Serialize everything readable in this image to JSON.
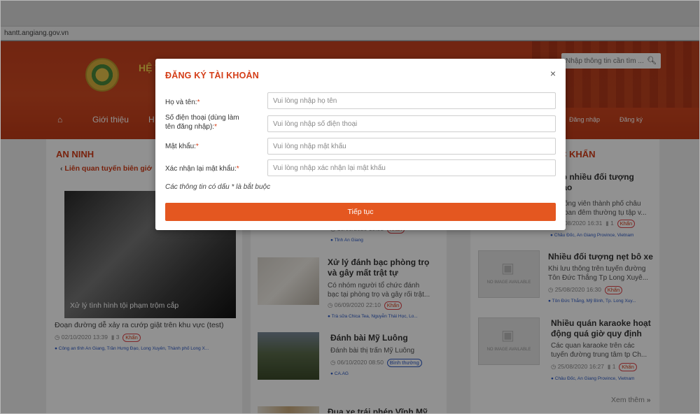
{
  "browser": {
    "url": "hantt.angiang.gov.vn"
  },
  "header": {
    "site_title": "HỆ T",
    "search_placeholder": "Nhập thông tin cần tìm ...",
    "nav": {
      "home": "Giới thiệu",
      "partial": "H",
      "login": "Đăng nhập",
      "register": "Đăng ký"
    }
  },
  "left": {
    "section_title": "AN NINH",
    "sub_link": "Liên quan tuyến biên giớ",
    "featured": {
      "image_caption": "Xử lý tình hình tội phạm trộm cắp",
      "title": "Đoạn đường dễ xảy ra cướp giật trên khu vực (test)",
      "date": "02/10/2020 13:39",
      "comments": "3",
      "badge": "Khẩn",
      "location": "Công an tỉnh An Giang, Trần Hưng Đạo, Long Xuyên, Thành phố Long X..."
    }
  },
  "middle": {
    "articles": [
      {
        "meta_date": "10/09/2020 10:31",
        "badge": "Khẩn",
        "location": "Tỉnh An Giang"
      },
      {
        "title_l1": "Xử lý đánh bạc phòng trọ",
        "title_l2": "và gây mất trật tự",
        "desc_l1": "Có nhóm người tổ chức đánh",
        "desc_l2": "bạc tại phòng trọ và gây rối trật...",
        "date": "06/09/2020 22:10",
        "badge": "Khẩn",
        "location": "Trà sữa Chica Tea, Nguyễn Thái Học, Lo..."
      },
      {
        "title_l1": "Đánh bài Mỹ Luông",
        "desc_l1": "Đánh bài thị trấn Mỹ Luông",
        "date": "06/10/2020 08:50",
        "badge": "Bình thường",
        "location": "CA.AG"
      },
      {
        "title_l1": "Đua xe trái phép Vĩnh Mỹ"
      }
    ]
  },
  "right": {
    "section_title": "C KHẨN",
    "articles": [
      {
        "title_l1": "ập nhiều đối tượng",
        "title_l2": "hảo",
        "desc_l1": "ông viên thành phố châu",
        "desc_l2": "oan đêm thường tụ tập v...",
        "date": "08/2020 16:31",
        "comments": "1",
        "badge": "Khẩn",
        "location": "Châu Đốc, An Giang Province, Vietnam"
      },
      {
        "title_l1": "Nhiều đối tượng nẹt bô xe",
        "desc_l1": "Khi lưu thông trên tuyến đường",
        "desc_l2": "Tôn Đức Thắng Tp Long Xuyê...",
        "date": "25/08/2020 16:30",
        "badge": "Khẩn",
        "location": "Tôn Đức Thắng, Mỹ Bình, Tp. Long Xuy...",
        "noimg": "NO IMAGE AVAILABLE"
      },
      {
        "title_l1": "Nhiều quán karaoke hoạt",
        "title_l2": "động quá giờ quy định",
        "desc_l1": "Các quan karaoke trên các",
        "desc_l2": "tuyến đường trung tâm tp Ch...",
        "date": "25/08/2020 16:27",
        "comments": "1",
        "badge": "Khẩn",
        "location": "Châu Đốc, An Giang Province, Vietnam",
        "noimg": "NO IMAGE AVAILABLE"
      }
    ],
    "see_more": "Xem thêm"
  },
  "modal": {
    "title": "ĐĂNG KÝ TÀI KHOẢN",
    "close": "×",
    "fields": [
      {
        "label": "Họ và tên:",
        "placeholder": "Vui lòng nhập họ tên"
      },
      {
        "label_l1": "Số điện thoại (dùng làm",
        "label_l2": "tên đăng nhập):",
        "placeholder": "Vui lòng nhập số điện thoại"
      },
      {
        "label": "Mật khẩu:",
        "placeholder": "Vui lòng nhập mật khẩu"
      },
      {
        "label": "Xác nhận lại mật khẩu:",
        "placeholder": "Vui lòng nhập xác nhận lại mật khẩu"
      }
    ],
    "required_mark": "*",
    "note": "Các thông tin có dấu * là bắt buộc",
    "submit_label": "Tiếp tục"
  },
  "colors": {
    "brand": "#d43d17",
    "button": "#e45720",
    "link_blue": "#2b58c4"
  }
}
